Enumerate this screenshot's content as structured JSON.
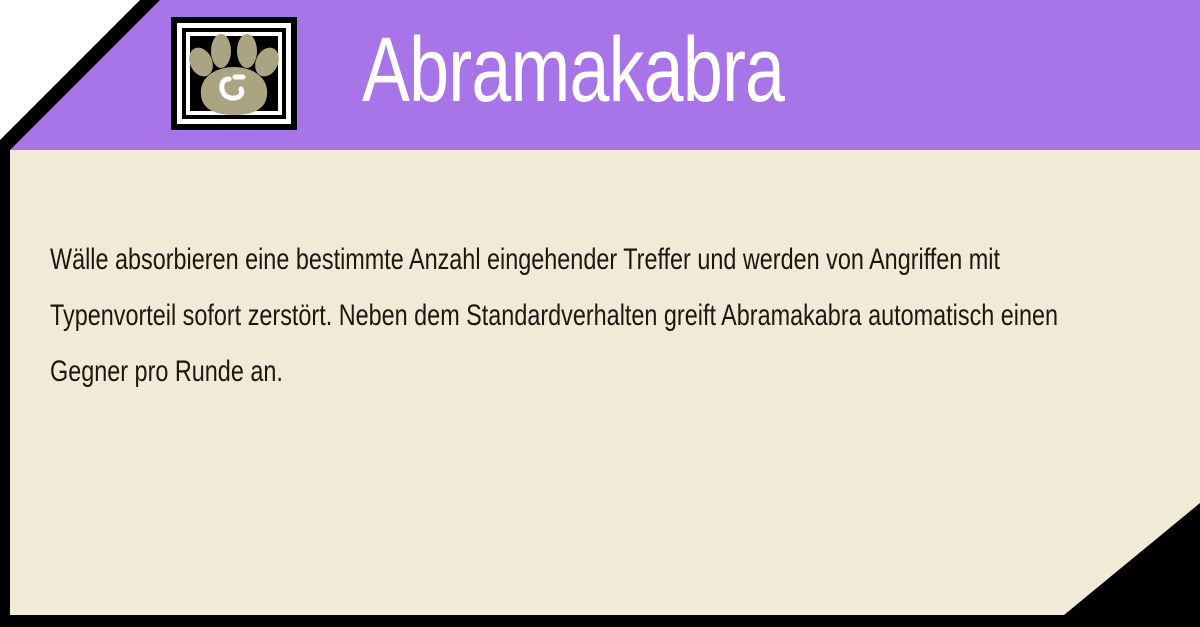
{
  "ability": {
    "title": "Abramakabra",
    "description": "Wälle absorbieren eine bestimmte Anzahl eingehender Treffer und werden von Angriffen mit Typenvorteil sofort zerstört. Neben dem Standardverhalten greift Abramakabra automatisch einen Gegner pro Runde an.",
    "icon": "paw-icon"
  },
  "colors": {
    "header": "#a875e8",
    "panel": "#f1ead6",
    "outline": "#000000",
    "title_text": "#ffffff",
    "body_text": "#1c1712",
    "icon_fill": "#aba482"
  }
}
